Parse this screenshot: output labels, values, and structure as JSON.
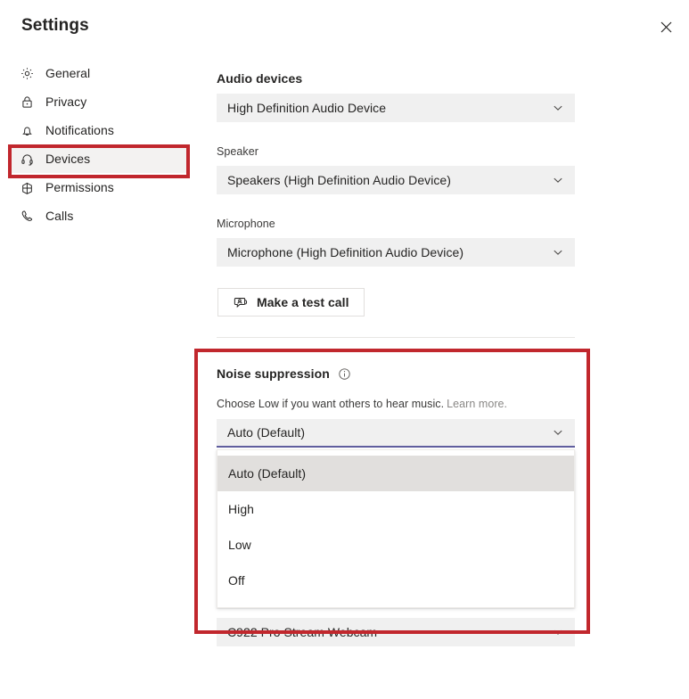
{
  "window": {
    "title": "Settings",
    "close_label": "✕",
    "close_icon": "close-icon"
  },
  "sidebar": {
    "items": [
      {
        "id": "general",
        "label": "General",
        "icon": "gear-icon",
        "selected": false
      },
      {
        "id": "privacy",
        "label": "Privacy",
        "icon": "lock-icon",
        "selected": false
      },
      {
        "id": "notifications",
        "label": "Notifications",
        "icon": "bell-icon",
        "selected": false
      },
      {
        "id": "devices",
        "label": "Devices",
        "icon": "headset-icon",
        "selected": true
      },
      {
        "id": "permissions",
        "label": "Permissions",
        "icon": "grid-apps-icon",
        "selected": false
      },
      {
        "id": "calls",
        "label": "Calls",
        "icon": "phone-icon",
        "selected": false
      }
    ]
  },
  "main": {
    "audio_section_title": "Audio devices",
    "audio_device": {
      "value": "High Definition Audio Device",
      "icon": "chevron-down-icon"
    },
    "speaker": {
      "label": "Speaker",
      "value": "Speakers (High Definition Audio Device)",
      "icon": "chevron-down-icon"
    },
    "microphone": {
      "label": "Microphone",
      "value": "Microphone (High Definition Audio Device)",
      "icon": "chevron-down-icon"
    },
    "test_call": {
      "label": "Make a test call",
      "icon": "person-call-icon"
    },
    "noise_suppression": {
      "title": "Noise suppression",
      "info_icon": "info-icon",
      "helper_text": "Choose Low if you want others to hear music.",
      "learn_more": "Learn more.",
      "selected_value": "Auto (Default)",
      "icon": "chevron-down-icon",
      "options": [
        {
          "label": "Auto (Default)",
          "highlighted": true
        },
        {
          "label": "High",
          "highlighted": false
        },
        {
          "label": "Low",
          "highlighted": false
        },
        {
          "label": "Off",
          "highlighted": false
        }
      ]
    },
    "camera": {
      "value": "C922 Pro Stream Webcam",
      "icon": "chevron-down-icon"
    }
  },
  "annotations": {
    "accent_color": "#c1272d",
    "focus_color": "#605e9e",
    "boxes": [
      {
        "id": "devices-highlight",
        "target": "sidebar-item-devices"
      },
      {
        "id": "noise-highlight",
        "target": "noise-suppression-section"
      }
    ]
  }
}
